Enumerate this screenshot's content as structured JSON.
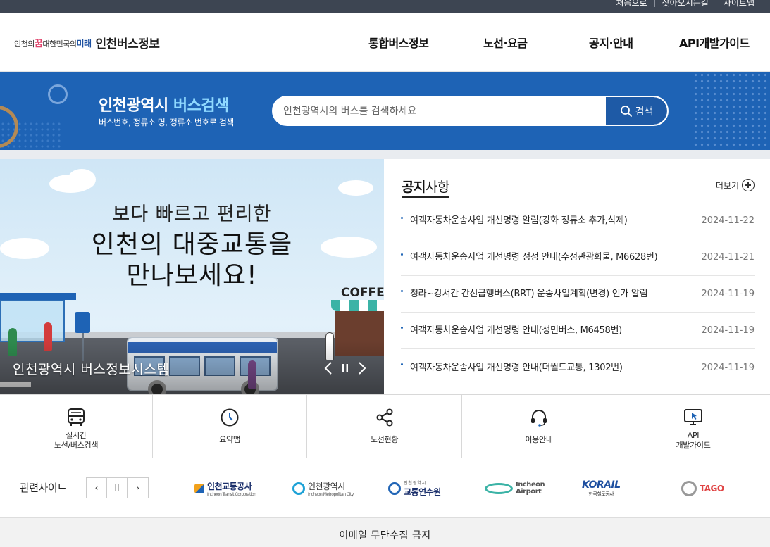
{
  "util_links": [
    "처음으로",
    "찾아오시는길",
    "사이트맵"
  ],
  "logo": {
    "slogan_pre": "인천의",
    "slogan_dream": "꿈",
    "slogan_mid": "대한민국의",
    "slogan_future": "미래",
    "title": "인천버스정보"
  },
  "nav": [
    "통합버스정보",
    "노선·요금",
    "공지·안내",
    "API개발가이드"
  ],
  "search": {
    "title_main": "인천광역시 ",
    "title_highlight": "버스검색",
    "subtitle": "버스번호, 정류소 명, 정류소 번호로 검색",
    "placeholder": "인천광역시의 버스를 검색하세요",
    "button_label": "검색"
  },
  "banner": {
    "subtitle": "보다 빠르고 편리한",
    "main_line1": "인천의 대중교통을",
    "main_line2": "만나보세요!",
    "cafe_sign": "COFFE",
    "caption": "인천광역시 버스정보시스템"
  },
  "notice": {
    "title_bold": "공지",
    "title_rest": "사항",
    "more_label": "더보기",
    "items": [
      {
        "text": "여객자동차운송사업 개선명령 알림(강화 정류소 추가,삭제)",
        "date": "2024-11-22"
      },
      {
        "text": "여객자동차운송사업 개선명령 정정 안내(수정관광화물, M6628번)",
        "date": "2024-11-21"
      },
      {
        "text": "청라~강서간 간선급행버스(BRT) 운송사업계획(변경) 인가 알림",
        "date": "2024-11-19"
      },
      {
        "text": "여객자동차운송사업 개선명령 안내(성민버스, M6458번)",
        "date": "2024-11-19"
      },
      {
        "text": "여객자동차운송사업 개선명령 안내(더월드교통, 1302번)",
        "date": "2024-11-19"
      }
    ]
  },
  "quick_menu": [
    {
      "label": "실시간\n노선/버스검색",
      "icon": "bus-icon"
    },
    {
      "label": "요약맵",
      "icon": "clock-icon"
    },
    {
      "label": "노선현황",
      "icon": "share-nodes-icon"
    },
    {
      "label": "이용안내",
      "icon": "headset-icon"
    },
    {
      "label": "API\n개발가이드",
      "icon": "monitor-cursor-icon"
    }
  ],
  "related": {
    "label": "관련사이트",
    "controls": [
      "‹",
      "II",
      "›"
    ],
    "sites": [
      {
        "name": "인천교통공사",
        "sub": "Incheon Transit Corporation"
      },
      {
        "name": "인천광역시",
        "sub": "Incheon Metropolitan City"
      },
      {
        "name": "교통연수원",
        "sub": "인 천 광 역 시"
      },
      {
        "name": "Incheon Airport",
        "sub": ""
      },
      {
        "name": "KORAIL",
        "sub": "한국철도공사"
      },
      {
        "name": "TAGO",
        "sub": ""
      }
    ]
  },
  "footer": {
    "text": "이메일 무단수집 금지"
  },
  "colors": {
    "topbar": "#3d4552",
    "search_band": "#1e63b5",
    "search_button": "#1e5aa6",
    "highlight": "#8fd9ff",
    "date": "#777777"
  }
}
